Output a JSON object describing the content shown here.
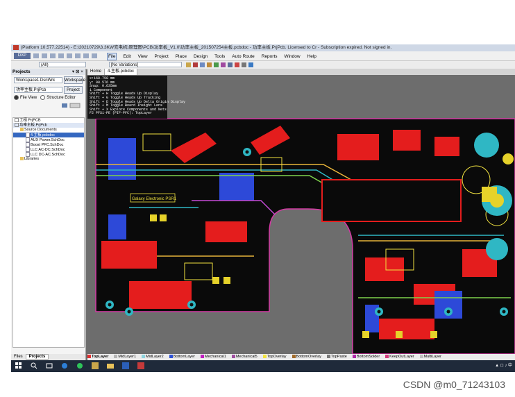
{
  "window": {
    "title": "(Platform 10.577.22514) - E:\\20210729\\3.3KW充电机\\原理图\\PCB\\功率板_V1.0\\功率主板_201507254主板.pcbdoc - 功率主板.PrjPcb. Licensed to Cr - Subscription expired. Not signed in."
  },
  "menubar": {
    "dxp_label": "DXP",
    "items": [
      "File",
      "Edit",
      "View",
      "Project",
      "Place",
      "Design",
      "Tools",
      "Auto Route",
      "Reports",
      "Window",
      "Help"
    ],
    "active_item": "File"
  },
  "toolbar": {
    "all_combo": "(All)",
    "variations_combo": "[No Variations]"
  },
  "projects_panel": {
    "title": "Projects",
    "workspace_value": "Workspace1.DsnWrk",
    "workspace_button": "Workspace",
    "project_value": "功率主板.PrjPcb",
    "project_button": "Project",
    "view_file": "File View",
    "view_structure": "Structure Editor",
    "tree": [
      {
        "label": "工程 PrjPCB",
        "level": 0,
        "kind": "box"
      },
      {
        "label": "功率主板.PrjPcb",
        "level": 0,
        "kind": "box",
        "state": "hl"
      },
      {
        "label": "Source Documents",
        "level": 1,
        "kind": "folder"
      },
      {
        "label": "4.主板.pcbdoc",
        "level": 2,
        "kind": "doc",
        "state": "sel"
      },
      {
        "label": "AUX Power.SchDoc",
        "level": 2,
        "kind": "doc"
      },
      {
        "label": "Boost PFC.SchDoc",
        "level": 2,
        "kind": "doc"
      },
      {
        "label": "LLC AC-DC.SchDoc",
        "level": 2,
        "kind": "doc"
      },
      {
        "label": "LLC DC-AC.SchDoc",
        "level": 2,
        "kind": "doc"
      },
      {
        "label": "Libraries",
        "level": 1,
        "kind": "folder"
      }
    ],
    "tabs": [
      "Files",
      "Projects"
    ],
    "active_tab": "Projects"
  },
  "doc_tabs": [
    "Home",
    "4.主板.pcbdoc"
  ],
  "active_doc_tab": "4.主板.pcbdoc",
  "hud": {
    "lines": [
      "x:168.758  mm",
      "y: 98.576  mm",
      "Snap: 0.635mm",
      "1 Component",
      "Shift + H  Toggle Heads Up Display",
      "Shift + G  Toggle Heads Up Tracking",
      "Shift + D  Toggle Heads Up Delta Origin Display",
      "Shift + M  Toggle Board Insight Lens",
      "Shift + X  Explore Components and Nets",
      "F2  PFS1-PE (PIF-PFC): TopLayer"
    ]
  },
  "silk_label": "Galaxy Electronic PSR1",
  "layers": [
    {
      "name": "TopLayer",
      "color": "#e23131"
    },
    {
      "name": "MidLayer1",
      "color": "#b5b5b5"
    },
    {
      "name": "MidLayer2",
      "color": "#8fd4de"
    },
    {
      "name": "BottomLayer",
      "color": "#2b4fd6"
    },
    {
      "name": "Mechanical1",
      "color": "#c020c0"
    },
    {
      "name": "Mechanical5",
      "color": "#a050a0"
    },
    {
      "name": "TopOverlay",
      "color": "#f2e340"
    },
    {
      "name": "BottomOverlay",
      "color": "#a06a2a"
    },
    {
      "name": "TopPaste",
      "color": "#7a7a7a"
    },
    {
      "name": "BottomSolder",
      "color": "#b02aa8"
    },
    {
      "name": "KeepOutLayer",
      "color": "#d23a7a"
    },
    {
      "name": "MultiLayer",
      "color": "#c0c0c0"
    }
  ],
  "active_layer": "TopLayer",
  "taskbar": {
    "icons": [
      "windows-start",
      "search",
      "task-view",
      "edge",
      "wechat",
      "altium",
      "explorer",
      "word",
      "pdf-viewer"
    ]
  },
  "watermark": "CSDN @m0_71243103",
  "colors": {
    "board_bg": "#0a0a0a",
    "workspace_bg": "#6d6d6d",
    "copper_top": "#e41d1d",
    "copper_bottom": "#2d49d8",
    "silk": "#f2e340",
    "outline": "#d43aa4"
  }
}
